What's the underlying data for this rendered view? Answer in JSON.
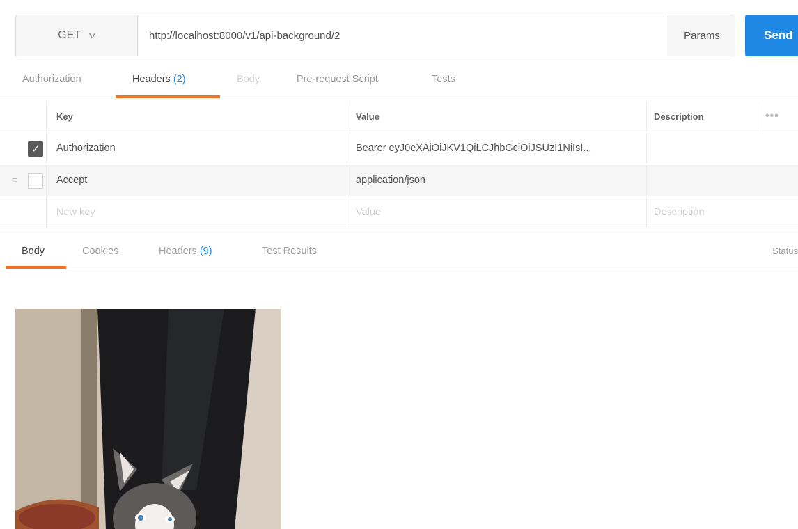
{
  "request": {
    "method": "GET",
    "url": "http://localhost:8000/v1/api-background/2",
    "params_label": "Params",
    "send_label": "Send"
  },
  "request_tabs": [
    {
      "label": "Authorization"
    },
    {
      "label": "Headers",
      "count": "(2)"
    },
    {
      "label": "Body"
    },
    {
      "label": "Pre-request Script"
    },
    {
      "label": "Tests"
    }
  ],
  "headers_table": {
    "columns": {
      "key": "Key",
      "value": "Value",
      "description": "Description",
      "more": "•••"
    },
    "rows": [
      {
        "checked": true,
        "key": "Authorization",
        "value": "Bearer eyJ0eXAiOiJKV1QiLCJhbGciOiJSUzI1NiIsI..."
      },
      {
        "checked": false,
        "key": "Accept",
        "value": "application/json"
      }
    ],
    "new_row": {
      "key_placeholder": "New key",
      "value_placeholder": "Value",
      "description_placeholder": "Description"
    }
  },
  "response_tabs": [
    {
      "label": "Body"
    },
    {
      "label": "Cookies"
    },
    {
      "label": "Headers",
      "count": "(9)"
    },
    {
      "label": "Test Results"
    }
  ],
  "status_label": "Status",
  "colors": {
    "accent": "#1f88e5",
    "tab_underline": "#f47023"
  },
  "icons": {
    "method_dropdown": "chevron-down-icon",
    "checkbox": "checkmark-icon",
    "drag": "drag-handle-icon",
    "more": "more-options-icon"
  }
}
